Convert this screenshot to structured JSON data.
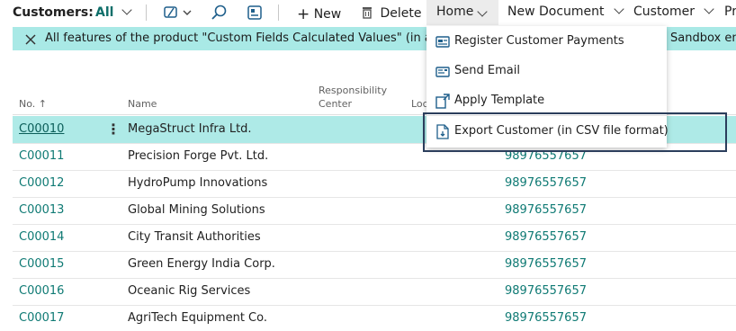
{
  "toolbar": {
    "title": "Customers:",
    "view": "All",
    "new_label": "New",
    "delete_label": "Delete",
    "home_label": "Home",
    "new_document_label": "New Document",
    "customer_label": "Customer",
    "overflow_label": "Pr"
  },
  "banner": {
    "message": "All features of the product \"Custom Fields Calculated Values\" (in app",
    "message_tail": "Sandbox en"
  },
  "table": {
    "headers": {
      "no": "No. ↑",
      "name": "Name",
      "responsibility_center": "Responsibility Center",
      "location": "Loc"
    },
    "rows": [
      {
        "no": "C00010",
        "name": "MegaStruct Infra Ltd.",
        "phone": ""
      },
      {
        "no": "C00011",
        "name": "Precision Forge Pvt. Ltd.",
        "phone": "98976557657"
      },
      {
        "no": "C00012",
        "name": "HydroPump Innovations",
        "phone": "98976557657"
      },
      {
        "no": "C00013",
        "name": "Global Mining Solutions",
        "phone": "98976557657"
      },
      {
        "no": "C00014",
        "name": "City Transit Authorities",
        "phone": "98976557657"
      },
      {
        "no": "C00015",
        "name": "Green Energy India Corp.",
        "phone": "98976557657"
      },
      {
        "no": "C00016",
        "name": "Oceanic Rig Services",
        "phone": "98976557657"
      },
      {
        "no": "C00017",
        "name": "AgriTech Equipment Co.",
        "phone": "98976557657"
      }
    ]
  },
  "home_menu": {
    "items": [
      {
        "label": "Register Customer Payments",
        "icon": "payment-journal-icon"
      },
      {
        "label": "Send Email",
        "icon": "email-icon"
      },
      {
        "label": "Apply Template",
        "icon": "apply-template-icon"
      },
      {
        "label": "Export Customer (in CSV file format)",
        "icon": "export-document-icon"
      }
    ]
  },
  "colors": {
    "accent": "#0f7a74",
    "banner_bg": "#a9e9e6",
    "selected_row": "#aeeae7",
    "highlight_border": "#2b3e5c"
  }
}
